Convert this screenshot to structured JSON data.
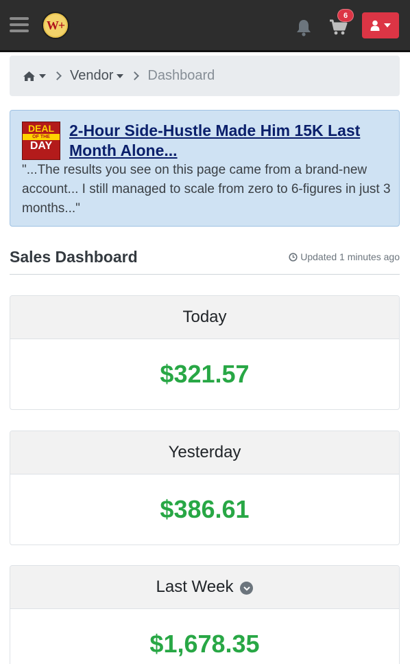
{
  "navbar": {
    "logo_text": "W+",
    "cart_count": "6",
    "icons": [
      "menu-icon",
      "bell-icon",
      "cart-icon",
      "user-icon"
    ],
    "user_button_color": "#dc3545"
  },
  "breadcrumb": {
    "home_icon": "home-icon",
    "vendor_label": "Vendor",
    "current_label": "Dashboard"
  },
  "deal": {
    "badge_line1": "DEAL",
    "badge_line2": "OF THE",
    "badge_line3": "DAY",
    "title": "2-Hour Side-Hustle Made Him 15K Last Month Alone...",
    "text": "\"...The results you see on this page came from a brand-new account... I still managed to scale from zero to 6-figures in just 3 months...\""
  },
  "dashboard": {
    "title": "Sales Dashboard",
    "updated": "Updated 1 minutes ago",
    "cards": [
      {
        "label": "Today",
        "value": "$321.57"
      },
      {
        "label": "Yesterday",
        "value": "$386.61"
      },
      {
        "label": "Last Week",
        "value": "$1,678.35"
      }
    ],
    "value_color": "#28a745"
  }
}
